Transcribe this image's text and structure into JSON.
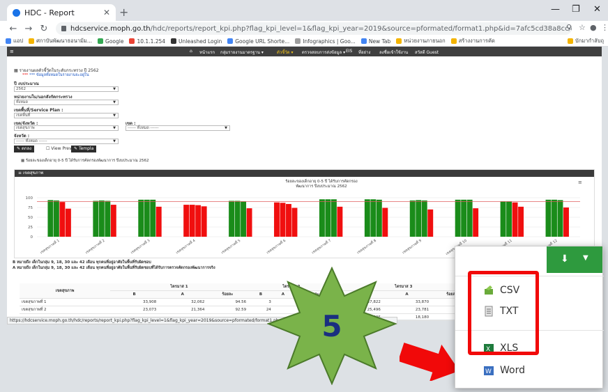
{
  "browser": {
    "tab_title": "HDC - Report",
    "url_host": "hdcservice.moph.go.th",
    "url_path": "/hdc/reports/report_kpi.php?flag_kpi_level=1&flag_kpi_year=2019&source=pformated/format1.php&id=7afc5cd38a8cc47af037cbd3613f268b",
    "bookmarks": [
      "แอป",
      "ศกาบันพัฒนาธอนาม้ม...",
      "Google",
      "10.1.1.254",
      "Unleashed Login",
      "Google URL Shorte...",
      "Infographics | Goo...",
      "New Tab",
      "หน่วยงานภายนอก",
      "สร้างงานการคัด",
      "บักมากำลับถุ"
    ]
  },
  "appnav": {
    "items": [
      "หน้าแรก",
      "กลุ่มรายงานมาตรฐาน ▾",
      "ตัวชี้วัด ▾",
      "ตรวจสอบการส่งข้อมูล ▾",
      "EIS",
      "ที่อย่าง",
      "ลงชื่อเข้าใช้งาน",
      "สวัสดี Guest"
    ]
  },
  "page": {
    "report_title": "รายงานผลตัวชี้วัดในระดับกระทรวง ปี 2562",
    "notice": "*** ข้อมูลทั้งหมดในรายงานจะอยู่ใน",
    "filters": {
      "year_label": "ปี งบประมาณ",
      "year_value": "2562",
      "unit_label": "หน่วยงานใน/นอกสังกัดกระทรวง",
      "unit_value": "ทั้งหมด",
      "plan_label": "เขตพื้นที่/Service Plan :",
      "plan_value": "เขตพื้นที่",
      "zone_label": "เขต/จังหวัด :",
      "zone_value": "เขตสุขภาพ",
      "area_label": "เขต :",
      "area_value": "------ ทั้งหมด ------",
      "province_label": "จังหวัด :",
      "province_value": "------ ทั้งหมด ------"
    },
    "buttons": {
      "export": "ตกลง",
      "view_prev": "View Prev",
      "template": "Templa"
    },
    "indicator_caption": "ร้อยละของเด็กอายุ 0-5 ปี ได้รับการคัดกรองพัฒนาการ ปีงบประมาณ 2562",
    "chart_panel_title": "เขตสุขภาพ",
    "footnote1": "B หมายถึง เด็กในกลุ่ม 9, 18, 30 และ 42 เดือน ทุกคนที่อยู่อาศัยในพื้นที่รับผิดชอบ",
    "footnote2": "A หมายถึง เด็กในกลุ่ม 9, 18, 30 และ 42 เดือน ทุกคนที่อยู่อาศัยในพื้นที่รับผิดชอบที่ได้รับการตรวจคัดกรองพัฒนาการจริง",
    "table": {
      "header_region": "เขตสุขภาพ",
      "groups": [
        "ไตรมาส 1",
        "ไตรมาส 2",
        "ไตรมาส 3"
      ],
      "subcols": [
        "B",
        "A",
        "ร้อยละ"
      ],
      "rows": [
        {
          "name": "เขตสุขภาพที่ 1",
          "cells": [
            "33,908",
            "32,062",
            "94.56",
            "3",
            "",
            "",
            "37,822",
            "33,870",
            ""
          ]
        },
        {
          "name": "เขตสุขภาพที่ 2",
          "cells": [
            "23,073",
            "21,364",
            "92.59",
            "24",
            "",
            "",
            "25,496",
            "23,781",
            ""
          ]
        },
        {
          "name": "",
          "cells": [
            "",
            "",
            "",
            "",
            "",
            "",
            "306",
            "18,180",
            ""
          ]
        }
      ]
    },
    "status_url": "https://hdcservice.moph.go.th/hdc/reports/report_kpi.php?flag_kpi_level=1&flag_kpi_year=2019&source=pformated/format1.php&id=7afc5cd38a8cc47af037cbd3613f268b"
  },
  "chart_data": {
    "type": "bar",
    "title": "ร้อยละของเด็กอายุ 0-5 ปี ได้รับการคัดกรอง\nพัฒนาการ ปีงบประมาณ 2562",
    "ylim": [
      0,
      100
    ],
    "yticks": [
      0,
      25,
      50,
      75,
      100
    ],
    "target_line": 90,
    "categories": [
      "เขตสุขภาพที่ 1",
      "เขตสุขภาพที่ 2",
      "เขตสุขภาพที่ 3",
      "เขตสุขภาพที่ 4",
      "เขตสุขภาพที่ 5",
      "เขตสุขภาพที่ 6",
      "เขตสุขภาพที่ 7",
      "เขตสุขภาพที่ 8",
      "เขตสุขภาพที่ 9",
      "เขตสุขภาพที่ 10",
      "เขตสุขภาพที่ 11",
      "เขตสุขภาพที่ 12"
    ],
    "series": [
      {
        "values": [
          94,
          92,
          95,
          82,
          92,
          88,
          96,
          96,
          93,
          95,
          91,
          95
        ]
      },
      {
        "values": [
          93,
          93,
          95,
          82,
          92,
          87,
          96,
          96,
          94,
          95,
          91,
          95
        ]
      },
      {
        "values": [
          89,
          92,
          95,
          81,
          91,
          84,
          96,
          95,
          93,
          95,
          88,
          94
        ]
      },
      {
        "values": [
          72,
          82,
          77,
          78,
          73,
          74,
          77,
          74,
          70,
          73,
          77,
          75
        ]
      }
    ],
    "colors": {
      "green": "#1a8c1a",
      "red": "#f00f0f",
      "target": "#e06060"
    }
  },
  "export_menu": {
    "items": [
      "CSV",
      "TXT",
      "XLS",
      "Word"
    ]
  },
  "annotation": {
    "step_number": "5"
  }
}
